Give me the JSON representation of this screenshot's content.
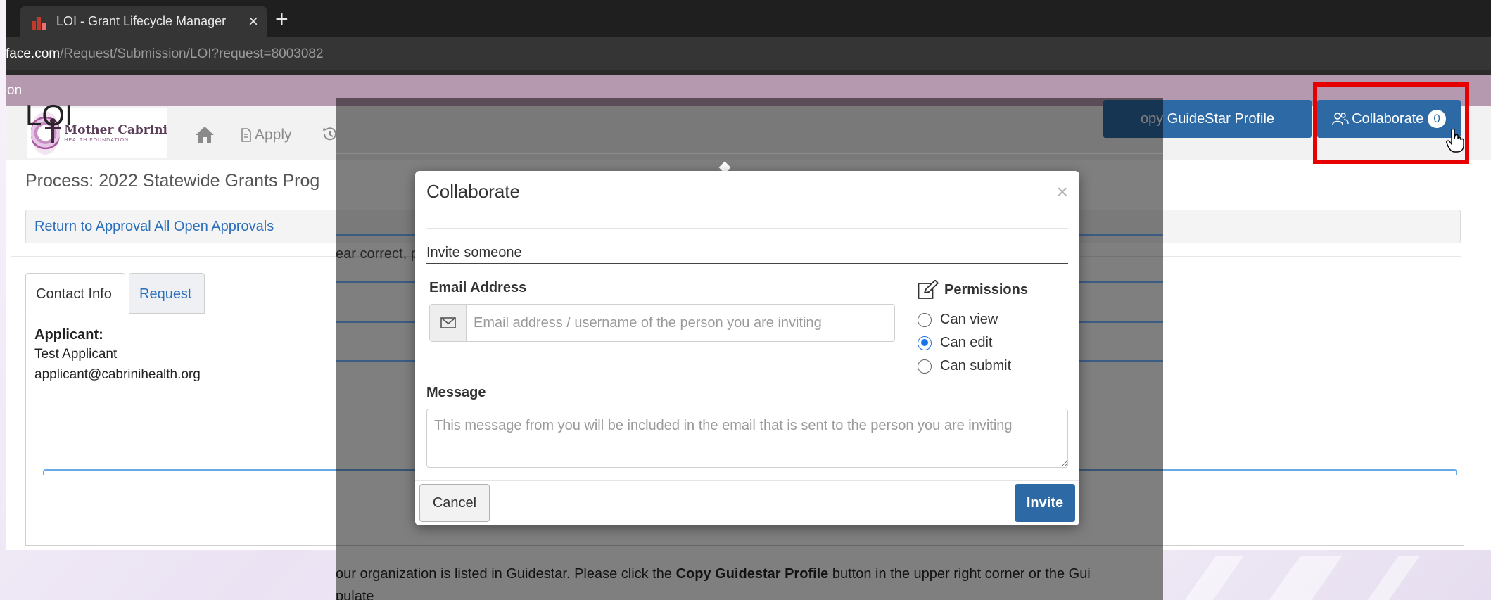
{
  "browser": {
    "tab_title": "LOI - Grant Lifecycle Manager",
    "tab_close": "×",
    "new_tab": "+",
    "url_domain": "face.com",
    "url_path": "/Request/Submission/LOI?request=8003082"
  },
  "banner": {
    "text": "on"
  },
  "nav": {
    "logo_name": "Mother Cabrini",
    "logo_sub": "HEALTH FOUNDATION",
    "apply_label": "Apply"
  },
  "page": {
    "title": "LOI",
    "process": "Process: 2022 Statewide Grants Prog",
    "return_link": "Return to Approval All Open Approvals",
    "tabs": [
      {
        "label": "Contact Info"
      },
      {
        "label": "Request"
      }
    ],
    "applicant_label": "Applicant:",
    "applicant_name": "Test Applicant",
    "applicant_email": "applicant@cabrinihealth.org",
    "buttons": {
      "guidestar": "opy GuideStar Profile",
      "collaborate": "Collaborate",
      "collaborate_count": "0"
    }
  },
  "background_text": {
    "partial_notice": "ear correct, p",
    "guidestar_prefix": "our organization is listed in Guidestar. Please click the ",
    "guidestar_bold": "Copy Guidestar Profile",
    "guidestar_suffix": " button in the upper right corner or the Gui",
    "guidestar_line2": "pulate"
  },
  "modal": {
    "title": "Collaborate",
    "close": "×",
    "invite_legend": "Invite someone",
    "email_label": "Email Address",
    "email_placeholder": "Email address / username of the person you are inviting",
    "permissions_label": "Permissions",
    "permissions": [
      {
        "label": "Can view",
        "checked": false
      },
      {
        "label": "Can edit",
        "checked": true
      },
      {
        "label": "Can submit",
        "checked": false
      }
    ],
    "message_label": "Message",
    "message_placeholder": "This message from you will be included in the email that is sent to the person you are inviting",
    "cancel_label": "Cancel",
    "invite_label": "Invite"
  },
  "colors": {
    "primary_button": "#2d6aa5",
    "banner": "#b59aaf",
    "highlight": "#e60000",
    "link": "#2a6ebb"
  }
}
